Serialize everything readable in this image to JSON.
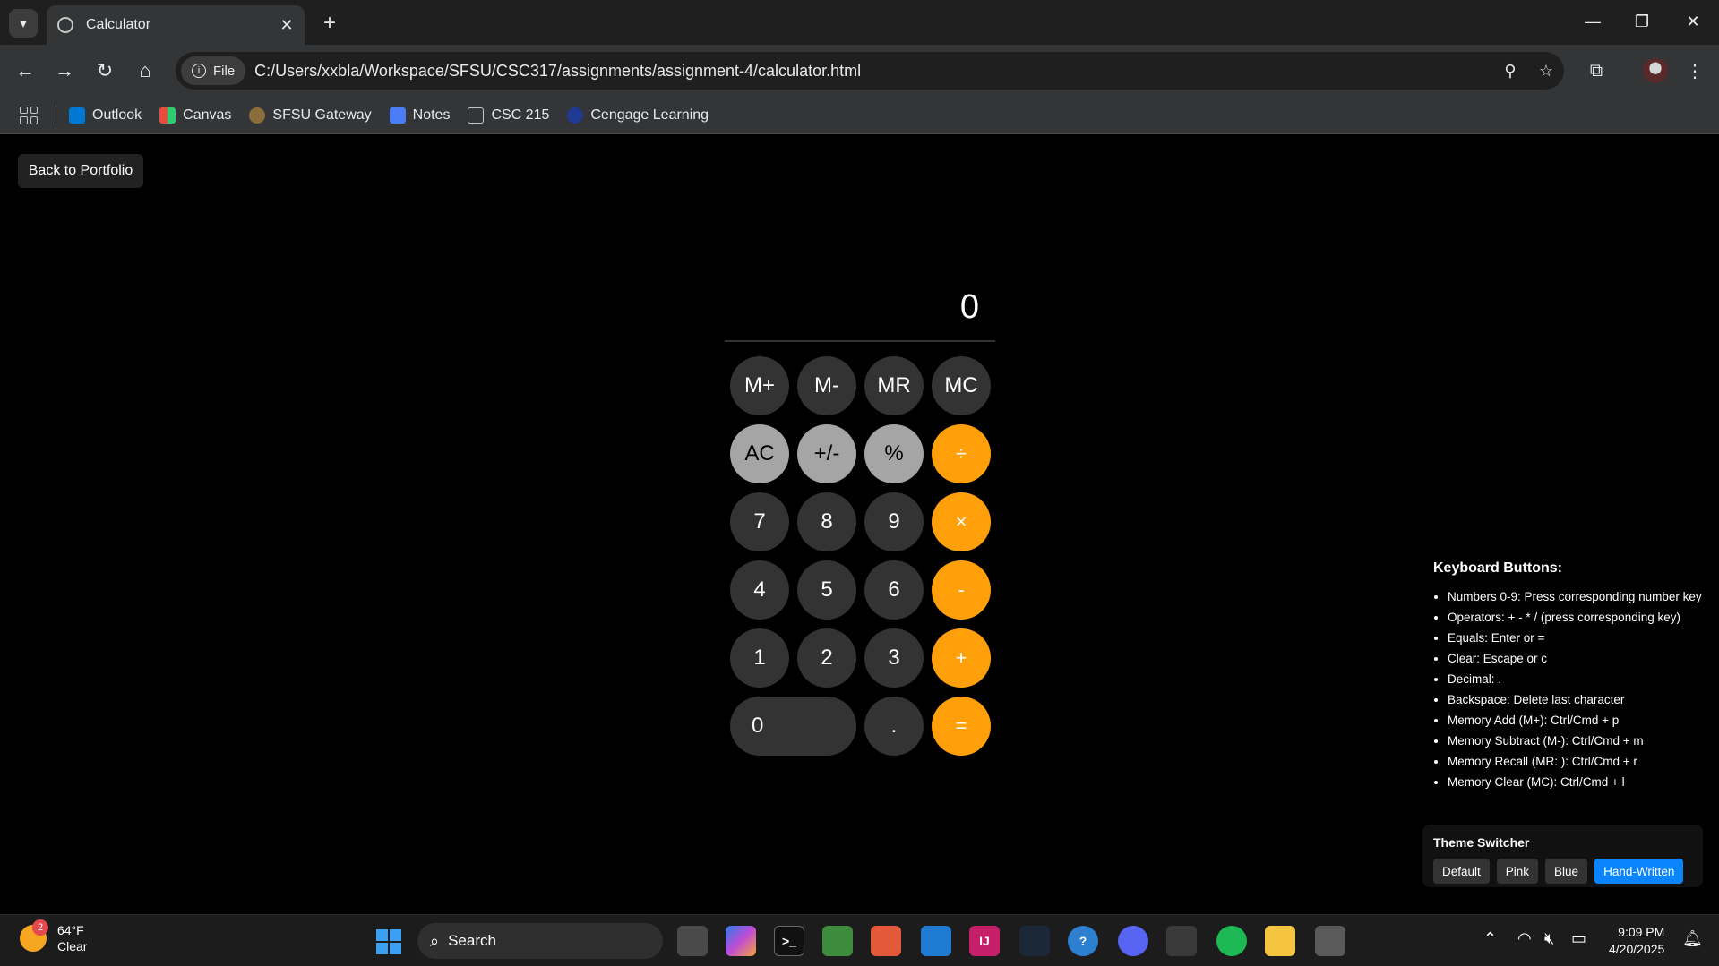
{
  "browser": {
    "tab_title": "Calculator",
    "omnibox_chip": "File",
    "url": "C:/Users/xxbla/Workspace/SFSU/CSC317/assignments/assignment-4/calculator.html"
  },
  "bookmarks": [
    {
      "label": "Outlook",
      "color": "#0078d4"
    },
    {
      "label": "Canvas",
      "color": "#e74c3c"
    },
    {
      "label": "SFSU Gateway",
      "color": "#8a6d3b"
    },
    {
      "label": "Notes",
      "color": "#4a7cf7"
    },
    {
      "label": "CSC 215",
      "color": "transparent"
    },
    {
      "label": "Cengage Learning",
      "color": "#1f3a93"
    }
  ],
  "page": {
    "back_button": "Back to Portfolio",
    "display": "0",
    "buttons": {
      "mplus": "M+",
      "mminus": "M-",
      "mr": "MR",
      "mc": "MC",
      "ac": "AC",
      "sign": "+/-",
      "percent": "%",
      "divide": "÷",
      "seven": "7",
      "eight": "8",
      "nine": "9",
      "multiply": "×",
      "four": "4",
      "five": "5",
      "six": "6",
      "minus": "-",
      "one": "1",
      "two": "2",
      "three": "3",
      "plus": "+",
      "zero": "0",
      "decimal": ".",
      "equals": "="
    },
    "keyboard": {
      "title": "Keyboard Buttons:",
      "items": [
        "Numbers 0-9: Press corresponding number key",
        "Operators: + - * / (press corresponding key)",
        "Equals: Enter or =",
        "Clear: Escape or c",
        "Decimal: .",
        "Backspace: Delete last character",
        "Memory Add (M+): Ctrl/Cmd + p",
        "Memory Subtract (M-): Ctrl/Cmd + m",
        "Memory Recall (MR: ): Ctrl/Cmd + r",
        "Memory Clear (MC): Ctrl/Cmd + l"
      ]
    },
    "theme": {
      "title": "Theme Switcher",
      "options": [
        "Default",
        "Pink",
        "Blue",
        "Hand-Written"
      ],
      "active": "Hand-Written"
    }
  },
  "taskbar": {
    "weather_badge": "2",
    "temperature": "64°F",
    "condition": "Clear",
    "search_label": "Search",
    "time": "9:09 PM",
    "date": "4/20/2025"
  },
  "colors": {
    "accent_orange": "#ff9f0a",
    "function_gray": "#a5a5a5",
    "dark_gray": "#333333",
    "active_blue": "#0a84ff"
  }
}
